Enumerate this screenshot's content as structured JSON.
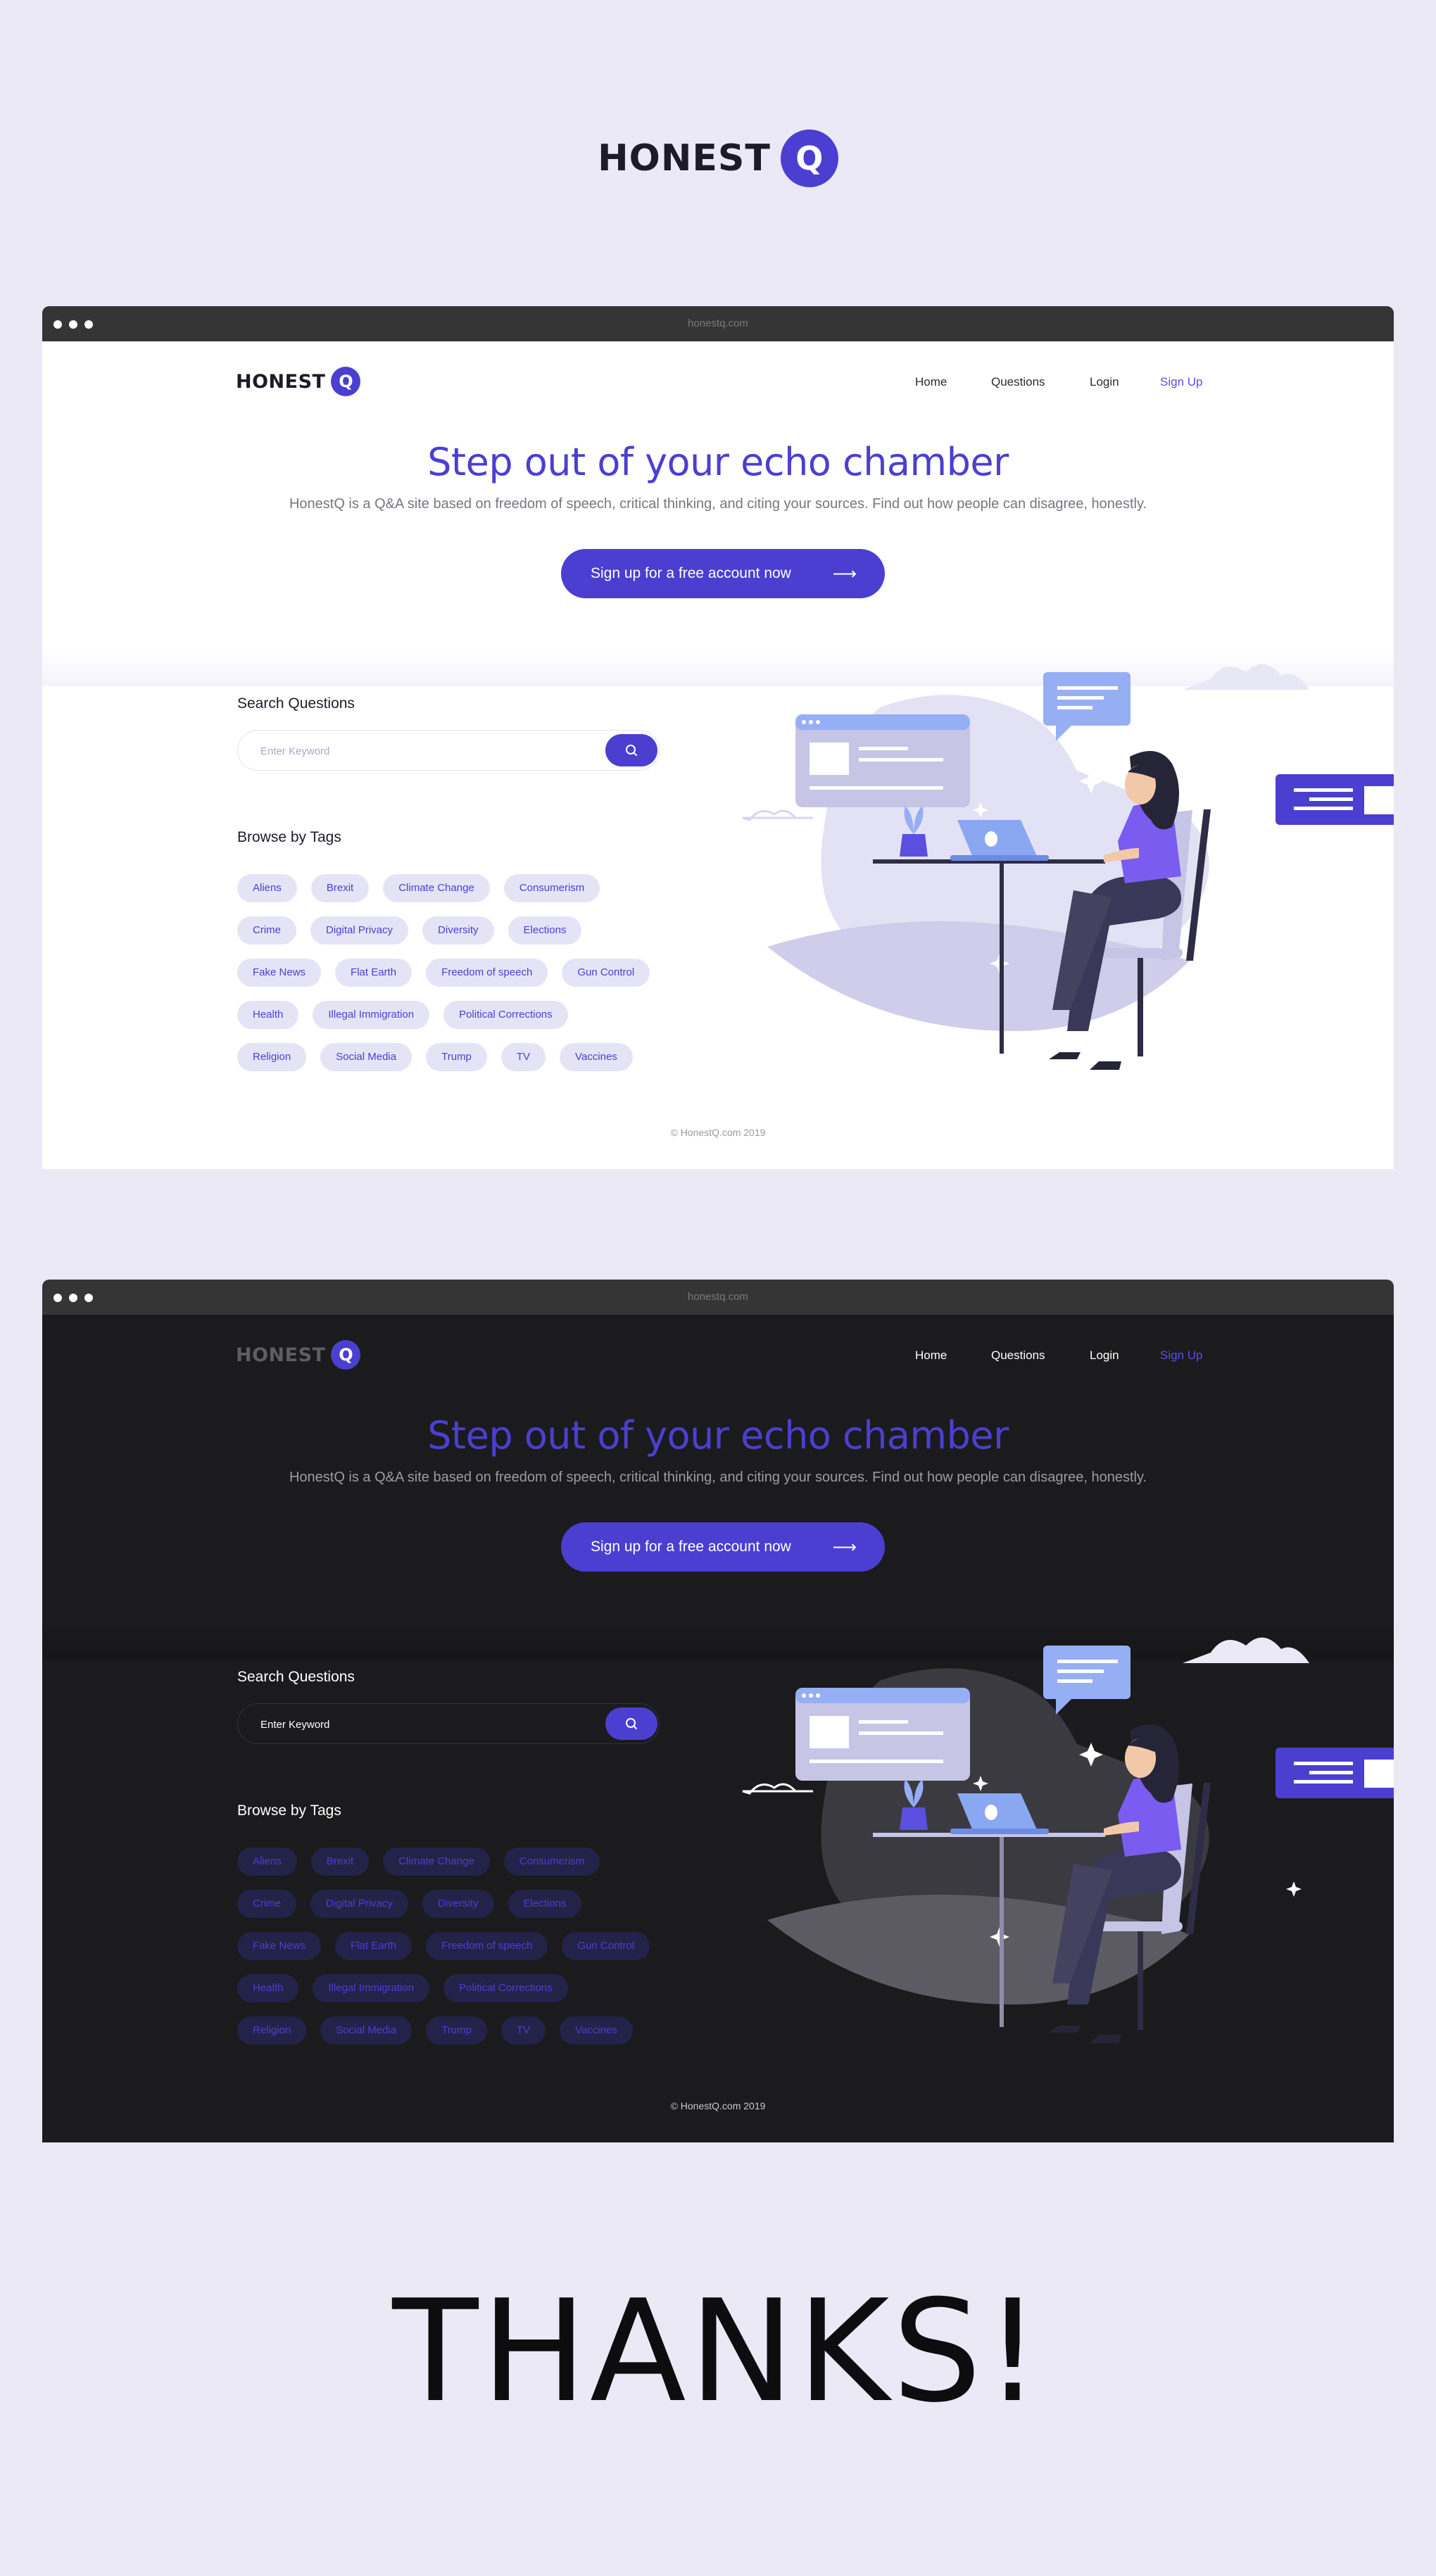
{
  "brand": {
    "name": "HONEST",
    "badge": "Q"
  },
  "mockups": [
    {
      "theme": "light",
      "url": "honestq.com",
      "logo": {
        "name": "HONEST",
        "badge": "Q"
      },
      "nav": {
        "home": "Home",
        "questions": "Questions",
        "login": "Login",
        "signup": "Sign Up"
      },
      "hero": {
        "title": "Step out of your echo chamber",
        "subtitle": "HonestQ is a Q&A site based on freedom of speech, critical thinking, and  citing your sources. Find out how people can disagree, honestly.",
        "cta": "Sign up for a free account now",
        "cta_arrow": "⟶"
      },
      "search": {
        "label": "Search Questions",
        "placeholder": "Enter Keyword"
      },
      "tags_label": "Browse by Tags",
      "tags": [
        [
          "Aliens",
          "Brexit",
          "Climate Change",
          "Consumerism"
        ],
        [
          "Crime",
          "Digital Privacy",
          "Diversity",
          "Elections"
        ],
        [
          "Fake News",
          "Flat Earth",
          "Freedom of speech",
          "Gun Control"
        ],
        [
          "Health",
          "Illegal Immigration",
          "Political Corrections"
        ],
        [
          "Religion",
          "Social Media",
          "Trump",
          "TV",
          "Vaccines"
        ]
      ],
      "footer": "© HonestQ.com 2019"
    },
    {
      "theme": "dark",
      "url": "honestq.com",
      "logo": {
        "name": "HONEST",
        "badge": "Q"
      },
      "nav": {
        "home": "Home",
        "questions": "Questions",
        "login": "Login",
        "signup": "Sign Up"
      },
      "hero": {
        "title": "Step out of your echo chamber",
        "subtitle": "HonestQ is a Q&A site based on freedom of speech, critical thinking, and  citing your sources. Find out how people can disagree, honestly.",
        "cta": "Sign up for a free account now",
        "cta_arrow": "⟶"
      },
      "search": {
        "label": "Search Questions",
        "placeholder": "Enter Keyword"
      },
      "tags_label": "Browse by Tags",
      "tags": [
        [
          "Aliens",
          "Brexit",
          "Climate Change",
          "Consumerism"
        ],
        [
          "Crime",
          "Digital Privacy",
          "Diversity",
          "Elections"
        ],
        [
          "Fake News",
          "Flat Earth",
          "Freedom of speech",
          "Gun Control"
        ],
        [
          "Health",
          "Illegal Immigration",
          "Political Corrections"
        ],
        [
          "Religion",
          "Social Media",
          "Trump",
          "TV",
          "Vaccines"
        ]
      ],
      "footer": "© HonestQ.com 2019"
    }
  ],
  "closing": "THANKS!",
  "colors": {
    "accent": "#4b3fd1",
    "background": "#ebe9f6",
    "dark_page": "#1b1b1d",
    "light_page": "#ffffff"
  },
  "icons": [
    "search-icon",
    "arrow-right-icon",
    "window-dots-icon"
  ]
}
